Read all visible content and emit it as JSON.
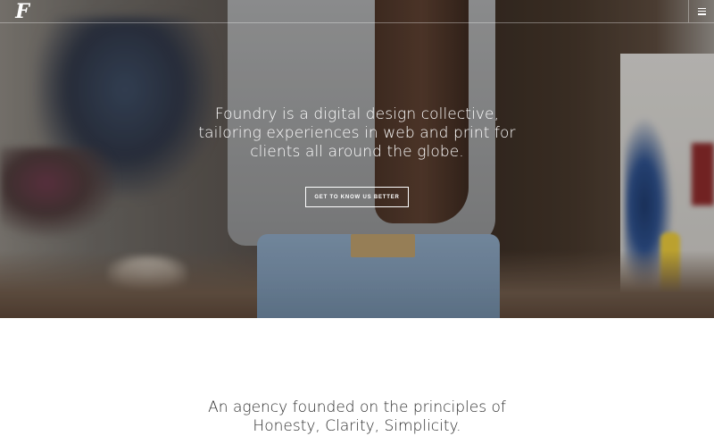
{
  "header": {
    "logo_text": "F",
    "menu_icon": "hamburger-menu-icon"
  },
  "hero": {
    "headline": "Foundry is a digital design collective, tailoring experiences in web and print for clients all around the globe.",
    "cta_label": "GET TO KNOW US BETTER"
  },
  "intro": {
    "line1": "An agency founded on the principles of",
    "line2": "Honesty, Clarity, Simplicity."
  }
}
